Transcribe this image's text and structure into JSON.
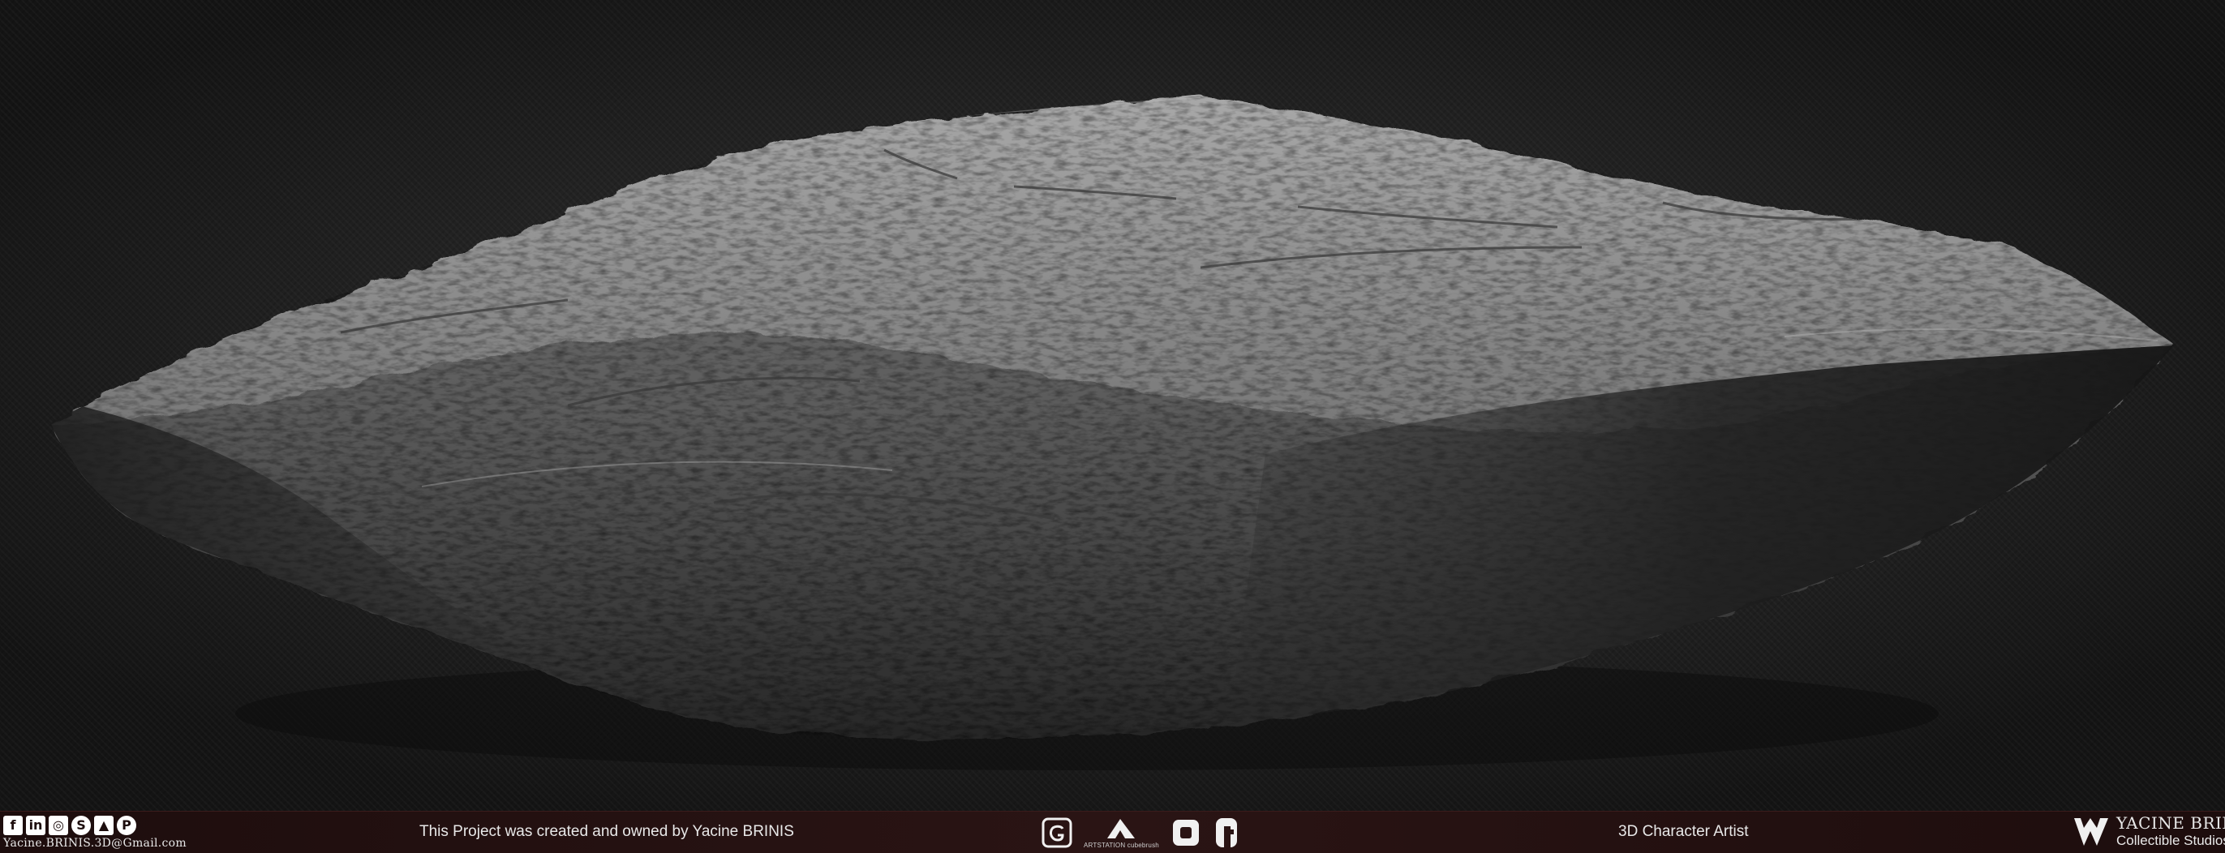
{
  "footer": {
    "social_icons": [
      "facebook-icon",
      "linkedin-icon",
      "instagram-icon",
      "skype-icon",
      "artstation-icon",
      "pinterest-icon"
    ],
    "email": "Yacine.BRINIS.3D@Gmail.com",
    "credit": "This Project was created and owned by Yacine BRINIS",
    "logos": [
      "gumroad-icon",
      "artstation-icon",
      "cubebrush-icon",
      "flippednormals-icon"
    ],
    "artstation_caption": "ARTSTATION cubebrush",
    "role": "3D Character Artist",
    "brand_name": "YACINE BRINIS",
    "brand_sub": "Collectible Studios"
  },
  "colors": {
    "background": "#1a1a1a",
    "footer_bg": "#2a1414",
    "footer_text": "#e8e8e8",
    "rock_light": "#9a9a9a",
    "rock_shadow": "#1c1c1c"
  }
}
